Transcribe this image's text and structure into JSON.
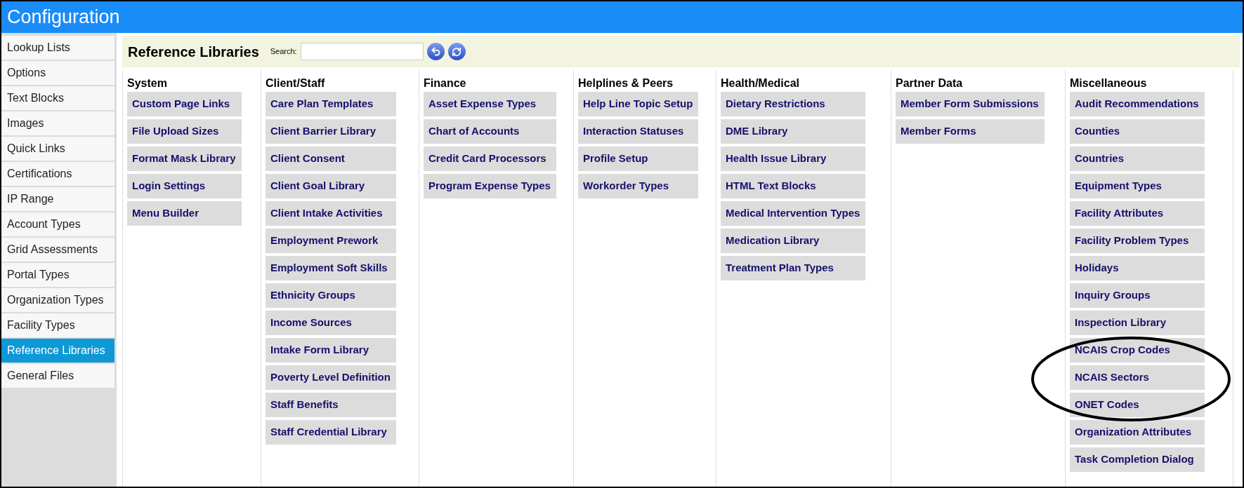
{
  "window": {
    "title": "Configuration"
  },
  "sidebar": {
    "items": [
      {
        "label": "Lookup Lists",
        "selected": false
      },
      {
        "label": "Options",
        "selected": false
      },
      {
        "label": "Text Blocks",
        "selected": false
      },
      {
        "label": "Images",
        "selected": false
      },
      {
        "label": "Quick Links",
        "selected": false
      },
      {
        "label": "Certifications",
        "selected": false
      },
      {
        "label": "IP Range",
        "selected": false
      },
      {
        "label": "Account Types",
        "selected": false
      },
      {
        "label": "Grid Assessments",
        "selected": false
      },
      {
        "label": "Portal Types",
        "selected": false
      },
      {
        "label": "Organization Types",
        "selected": false
      },
      {
        "label": "Facility Types",
        "selected": false
      },
      {
        "label": "Reference Libraries",
        "selected": true
      },
      {
        "label": "General Files",
        "selected": false
      }
    ]
  },
  "toolbar": {
    "title": "Reference Libraries",
    "search_label": "Search:"
  },
  "columns": [
    {
      "heading": "System",
      "links": [
        "Custom Page Links",
        "File Upload Sizes",
        "Format Mask Library",
        "Login Settings",
        "Menu Builder"
      ]
    },
    {
      "heading": "Client/Staff",
      "links": [
        "Care Plan Templates",
        "Client Barrier Library",
        "Client Consent",
        "Client Goal Library",
        "Client Intake Activities",
        "Employment Prework",
        "Employment Soft Skills",
        "Ethnicity Groups",
        "Income Sources",
        "Intake Form Library",
        "Poverty Level Definition",
        "Staff Benefits",
        "Staff Credential Library"
      ]
    },
    {
      "heading": "Finance",
      "links": [
        "Asset Expense Types",
        "Chart of Accounts",
        "Credit Card Processors",
        "Program Expense Types"
      ]
    },
    {
      "heading": "Helplines & Peers",
      "links": [
        "Help Line Topic Setup",
        "Interaction Statuses",
        "Profile Setup",
        "Workorder Types"
      ]
    },
    {
      "heading": "Health/Medical",
      "links": [
        "Dietary Restrictions",
        "DME Library",
        "Health Issue Library",
        "HTML Text Blocks",
        "Medical Intervention Types",
        "Medication Library",
        "Treatment Plan Types"
      ]
    },
    {
      "heading": "Partner Data",
      "links": [
        "Member Form Submissions",
        "Member Forms"
      ]
    },
    {
      "heading": "Miscellaneous",
      "links": [
        "Audit Recommendations",
        "Counties",
        "Countries",
        "Equipment Types",
        "Facility Attributes",
        "Facility Problem Types",
        "Holidays",
        "Inquiry Groups",
        "Inspection Library",
        "NCAIS Crop Codes",
        "NCAIS Sectors",
        "ONET Codes",
        "Organization Attributes",
        "Task Completion Dialog"
      ]
    }
  ]
}
